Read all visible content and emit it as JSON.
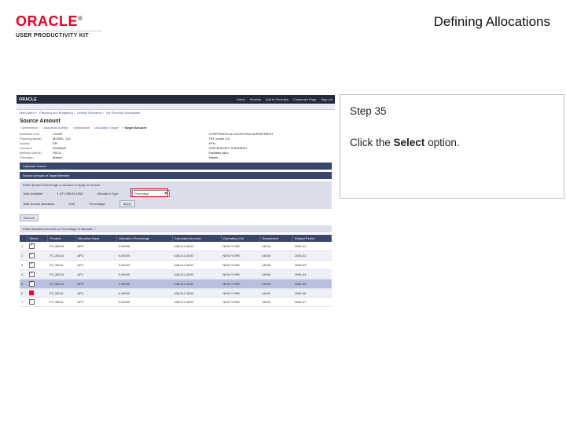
{
  "header": {
    "logo_text": "ORACLE",
    "logo_tm": "®",
    "subbrand": "USER PRODUCTIVITY KIT",
    "page_title": "Defining Allocations"
  },
  "instruction": {
    "step_label": "Step 35",
    "line1": "Click the ",
    "bold": "Select",
    "line2": " option."
  },
  "shot": {
    "brand": "ORACLE",
    "top_menus": [
      "Home",
      "Worklist",
      "Add to Favorites",
      "Customize Page",
      "Sign out"
    ],
    "breadcrumb": [
      "Main Menu",
      "Planning and Budgeting",
      "Activity Scenarios",
      "My Planning Workspace"
    ],
    "section_title": "Source Amount",
    "tabs": [
      "Dimensions",
      "Allocation Activity",
      "Destination",
      "Allocation Target",
      "Target Amount"
    ],
    "active_tab": 4,
    "form": [
      {
        "k": "Business Unit",
        "v": "US005"
      },
      {
        "k": "",
        "v": "CORPORATE ALLOCATIONS DEPARTMENT"
      },
      {
        "k": "Planning Model",
        "v": "MODEL_101"
      },
      {
        "k": "",
        "v": "TBT model 101"
      },
      {
        "k": "Activity",
        "v": "KPI"
      },
      {
        "k": "",
        "v": "KPIs"
      },
      {
        "k": "Scenario",
        "v": "2009BUD"
      },
      {
        "k": "",
        "v": "2009 BUDGET SCENARIO"
      },
      {
        "k": "Method Defn ID",
        "v": "FACIL"
      },
      {
        "k": "",
        "v": "Facilities Alloc"
      },
      {
        "k": "Execution",
        "v": "Master"
      },
      {
        "k": "",
        "v": "Master"
      }
    ],
    "band1": "Calculate Source",
    "band2": "Source Amount of Target Member",
    "summary_caption": "Enter Spread Percentage or Amount to Apply to Source",
    "summary": {
      "tot_label": "Total Available",
      "tot_value": "1,477,025.43  USD",
      "src_label": "Total Source Allocation",
      "src_value": "0.00",
      "type_label": "Allocation Type",
      "type_value": "Percentage",
      "pct_label": "Percentage",
      "select_value": "Percentage",
      "apply": "Apply"
    },
    "run_btn": "Refresh",
    "grid_caption": "Enter Allocation Amount or Percentage to allocate: 7",
    "columns": [
      "",
      "Select",
      "Product",
      "Allocation Base",
      "Allocation Percentage",
      "Calculated Amount",
      "Operating Unit",
      "Department",
      "Budget Period"
    ],
    "rows": [
      {
        "n": "1",
        "sel": true,
        "prod": "PC-30015",
        "base": "APC",
        "pct": "0.00000",
        "amt": "438,012.4300",
        "ou": "NEW YORK",
        "dept": "14000",
        "per": "2008-01"
      },
      {
        "n": "2",
        "sel": true,
        "prod": "PC-30015",
        "base": "APC",
        "pct": "0.00000",
        "amt": "438,012.4300",
        "ou": "NEW YORK",
        "dept": "14000",
        "per": "2008-02"
      },
      {
        "n": "3",
        "sel": true,
        "prod": "PC-30011",
        "base": "APC",
        "pct": "0.00000",
        "amt": "438,012.4300",
        "ou": "NEW YORK",
        "dept": "14000",
        "per": "2008-03"
      },
      {
        "n": "4",
        "sel": true,
        "prod": "PC-30015",
        "base": "APC",
        "pct": "0.00000",
        "amt": "438,012.4300",
        "ou": "NEW YORK",
        "dept": "14000",
        "per": "2008-04"
      },
      {
        "n": "5",
        "sel": true,
        "prod": "PC-30015",
        "base": "APC",
        "pct": "0.00000",
        "amt": "438,012.4300",
        "ou": "NEW YORK",
        "dept": "14000",
        "per": "2008-05"
      },
      {
        "n": "6",
        "sel": false,
        "prod": "PC-30011",
        "base": "APC",
        "pct": "0.00000",
        "amt": "438,012.4300",
        "ou": "NEW YORK",
        "dept": "14000",
        "per": "2008-06",
        "red": true
      },
      {
        "n": "7",
        "sel": false,
        "prod": "PC-30011",
        "base": "APC",
        "pct": "0.00000",
        "amt": "438,012.4300",
        "ou": "NEW YORK",
        "dept": "14000",
        "per": "2008-07"
      }
    ]
  }
}
